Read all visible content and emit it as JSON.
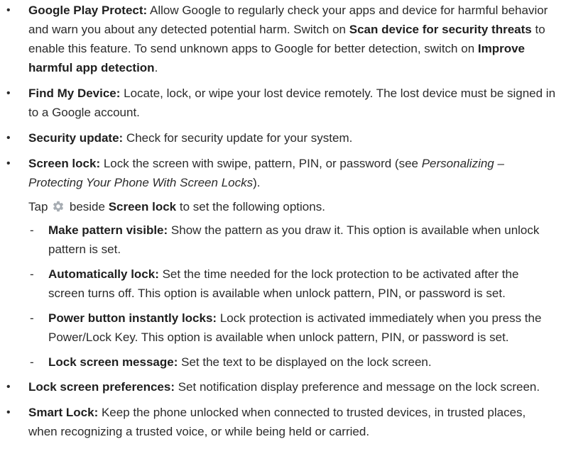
{
  "items": [
    {
      "title": "Google Play Protect:",
      "p1": " Allow Google to regularly check your apps and device for harmful behavior and warn you about any detected potential harm. Switch on ",
      "b1": "Scan device for security threats",
      "p2": " to enable this feature. To send unknown apps to Google for better detection, switch on ",
      "b2": "Improve harmful app detection",
      "p3": "."
    },
    {
      "title": "Find My Device:",
      "text": " Locate, lock, or wipe your lost device remotely. The lost device must be signed in to a Google account."
    },
    {
      "title": "Security update:",
      "text": " Check for security update for your system."
    },
    {
      "title": "Screen lock:",
      "p1": " Lock the screen with swipe, pattern, PIN, or password (see ",
      "italic": "Personalizing – Protecting Your Phone With Screen Locks",
      "p2": ")."
    }
  ],
  "note": {
    "pre": "Tap ",
    "icon": "gear-icon",
    "mid": " beside ",
    "bold": "Screen lock",
    "post": " to set the following options."
  },
  "subitems": [
    {
      "title": "Make pattern visible:",
      "text": " Show the pattern as you draw it. This option is available when unlock pattern is set."
    },
    {
      "title": "Automatically lock:",
      "text": " Set the time needed for the lock protection to be activated after the screen turns off. This option is available when unlock pattern, PIN, or password is set."
    },
    {
      "title": "Power button instantly locks:",
      "text": " Lock protection is activated immediately when you press the Power/Lock Key. This option is available when unlock pattern, PIN, or password is set."
    },
    {
      "title": "Lock screen message:",
      "text": " Set the text to be displayed on the lock screen."
    }
  ],
  "items2": [
    {
      "title": "Lock screen preferences:",
      "text": " Set notification display preference and message on the lock screen."
    },
    {
      "title": "Smart Lock:",
      "text": " Keep the phone unlocked when connected to trusted devices, in trusted places, when recognizing a trusted voice, or while being held or carried."
    }
  ],
  "colors": {
    "text": "#2b2b2b",
    "icon": "#a7adb3"
  }
}
